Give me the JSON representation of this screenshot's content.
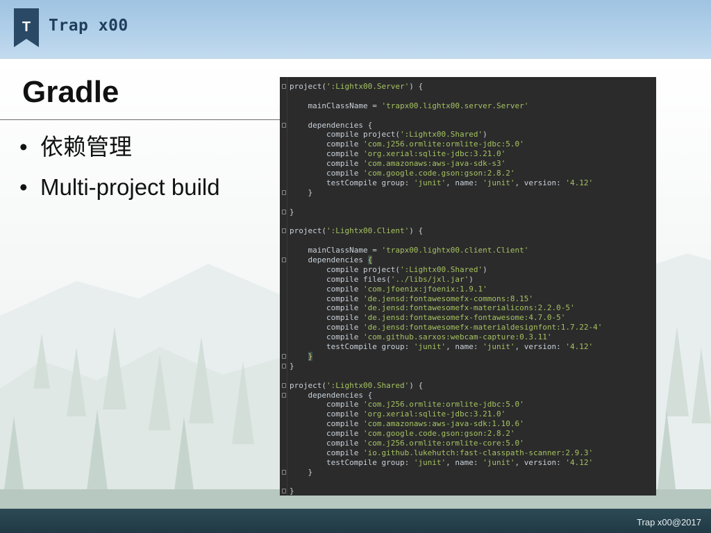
{
  "header": {
    "logo_letter": "T",
    "brand_name": "Trap x00"
  },
  "slide": {
    "title": "Gradle",
    "bullets": [
      {
        "bullet": "•",
        "text": "依赖管理"
      },
      {
        "bullet": "•",
        "text": "Multi-project build"
      }
    ]
  },
  "code": {
    "lines": [
      {
        "gutter": true,
        "segments": [
          {
            "t": "project("
          },
          {
            "t": "':Lightx00.Server'",
            "s": 1
          },
          {
            "t": ") {"
          }
        ]
      },
      {
        "gutter": false,
        "segments": []
      },
      {
        "gutter": false,
        "segments": [
          {
            "t": "    mainClassName = "
          },
          {
            "t": "'trapx00.lightx00.server.Server'",
            "s": 1
          }
        ]
      },
      {
        "gutter": false,
        "segments": []
      },
      {
        "gutter": true,
        "segments": [
          {
            "t": "    dependencies {"
          }
        ]
      },
      {
        "gutter": false,
        "segments": [
          {
            "t": "        compile project("
          },
          {
            "t": "':Lightx00.Shared'",
            "s": 1
          },
          {
            "t": ")"
          }
        ]
      },
      {
        "gutter": false,
        "segments": [
          {
            "t": "        compile "
          },
          {
            "t": "'com.j256.ormlite:ormlite-jdbc:5.0'",
            "s": 1
          }
        ]
      },
      {
        "gutter": false,
        "segments": [
          {
            "t": "        compile "
          },
          {
            "t": "'org.xerial:sqlite-jdbc:3.21.0'",
            "s": 1
          }
        ]
      },
      {
        "gutter": false,
        "segments": [
          {
            "t": "        compile "
          },
          {
            "t": "'com.amazonaws:aws-java-sdk-s3'",
            "s": 1
          }
        ]
      },
      {
        "gutter": false,
        "segments": [
          {
            "t": "        compile "
          },
          {
            "t": "'com.google.code.gson:gson:2.8.2'",
            "s": 1
          }
        ]
      },
      {
        "gutter": false,
        "segments": [
          {
            "t": "        testCompile group: "
          },
          {
            "t": "'junit'",
            "s": 1
          },
          {
            "t": ", name: "
          },
          {
            "t": "'junit'",
            "s": 1
          },
          {
            "t": ", version: "
          },
          {
            "t": "'4.12'",
            "s": 1
          }
        ]
      },
      {
        "gutter": true,
        "segments": [
          {
            "t": "    }"
          }
        ]
      },
      {
        "gutter": false,
        "segments": []
      },
      {
        "gutter": true,
        "segments": [
          {
            "t": "}"
          }
        ]
      },
      {
        "gutter": false,
        "segments": []
      },
      {
        "gutter": true,
        "segments": [
          {
            "t": "project("
          },
          {
            "t": "':Lightx00.Client'",
            "s": 1
          },
          {
            "t": ") {"
          }
        ]
      },
      {
        "gutter": false,
        "segments": []
      },
      {
        "gutter": false,
        "segments": [
          {
            "t": "    mainClassName = "
          },
          {
            "t": "'trapx00.lightx00.client.Client'",
            "s": 1
          }
        ]
      },
      {
        "gutter": true,
        "segments": [
          {
            "t": "    dependencies "
          },
          {
            "t": "{",
            "h": 1
          }
        ]
      },
      {
        "gutter": false,
        "segments": [
          {
            "t": "        compile project("
          },
          {
            "t": "':Lightx00.Shared'",
            "s": 1
          },
          {
            "t": ")"
          }
        ]
      },
      {
        "gutter": false,
        "segments": [
          {
            "t": "        compile files("
          },
          {
            "t": "'../libs/jxl.jar'",
            "s": 1
          },
          {
            "t": ")"
          }
        ]
      },
      {
        "gutter": false,
        "segments": [
          {
            "t": "        compile "
          },
          {
            "t": "'com.jfoenix:jfoenix:1.9.1'",
            "s": 1
          }
        ]
      },
      {
        "gutter": false,
        "segments": [
          {
            "t": "        compile "
          },
          {
            "t": "'de.jensd:fontawesomefx-commons:8.15'",
            "s": 1
          }
        ]
      },
      {
        "gutter": false,
        "segments": [
          {
            "t": "        compile "
          },
          {
            "t": "'de.jensd:fontawesomefx-materialicons:2.2.0-5'",
            "s": 1
          }
        ]
      },
      {
        "gutter": false,
        "segments": [
          {
            "t": "        compile "
          },
          {
            "t": "'de.jensd:fontawesomefx-fontawesome:4.7.0-5'",
            "s": 1
          }
        ]
      },
      {
        "gutter": false,
        "segments": [
          {
            "t": "        compile "
          },
          {
            "t": "'de.jensd:fontawesomefx-materialdesignfont:1.7.22-4'",
            "s": 1
          }
        ]
      },
      {
        "gutter": false,
        "segments": [
          {
            "t": "        compile "
          },
          {
            "t": "'com.github.sarxos:webcam-capture:0.3.11'",
            "s": 1
          }
        ]
      },
      {
        "gutter": false,
        "segments": [
          {
            "t": "        testCompile group: "
          },
          {
            "t": "'junit'",
            "s": 1
          },
          {
            "t": ", name: "
          },
          {
            "t": "'junit'",
            "s": 1
          },
          {
            "t": ", version: "
          },
          {
            "t": "'4.12'",
            "s": 1
          }
        ]
      },
      {
        "gutter": true,
        "segments": [
          {
            "t": "    "
          },
          {
            "t": "}",
            "h": 1
          }
        ]
      },
      {
        "gutter": true,
        "segments": [
          {
            "t": "}"
          }
        ]
      },
      {
        "gutter": false,
        "segments": []
      },
      {
        "gutter": true,
        "segments": [
          {
            "t": "project("
          },
          {
            "t": "':Lightx00.Shared'",
            "s": 1
          },
          {
            "t": ") {"
          }
        ]
      },
      {
        "gutter": true,
        "segments": [
          {
            "t": "    dependencies {"
          }
        ]
      },
      {
        "gutter": false,
        "segments": [
          {
            "t": "        compile "
          },
          {
            "t": "'com.j256.ormlite:ormlite-jdbc:5.0'",
            "s": 1
          }
        ]
      },
      {
        "gutter": false,
        "segments": [
          {
            "t": "        compile "
          },
          {
            "t": "'org.xerial:sqlite-jdbc:3.21.0'",
            "s": 1
          }
        ]
      },
      {
        "gutter": false,
        "segments": [
          {
            "t": "        compile "
          },
          {
            "t": "'com.amazonaws:aws-java-sdk:1.10.6'",
            "s": 1
          }
        ]
      },
      {
        "gutter": false,
        "segments": [
          {
            "t": "        compile "
          },
          {
            "t": "'com.google.code.gson:gson:2.8.2'",
            "s": 1
          }
        ]
      },
      {
        "gutter": false,
        "segments": [
          {
            "t": "        compile "
          },
          {
            "t": "'com.j256.ormlite:ormlite-core:5.0'",
            "s": 1
          }
        ]
      },
      {
        "gutter": false,
        "segments": [
          {
            "t": "        compile "
          },
          {
            "t": "'io.github.lukehutch:fast-classpath-scanner:2.9.3'",
            "s": 1
          }
        ]
      },
      {
        "gutter": false,
        "segments": [
          {
            "t": "        testCompile group: "
          },
          {
            "t": "'junit'",
            "s": 1
          },
          {
            "t": ", name: "
          },
          {
            "t": "'junit'",
            "s": 1
          },
          {
            "t": ", version: "
          },
          {
            "t": "'4.12'",
            "s": 1
          }
        ]
      },
      {
        "gutter": true,
        "segments": [
          {
            "t": "    }"
          }
        ]
      },
      {
        "gutter": false,
        "segments": []
      },
      {
        "gutter": true,
        "segments": [
          {
            "t": "}"
          }
        ]
      }
    ]
  },
  "footer": {
    "text": "Trap x00@2017"
  },
  "colors": {
    "header_blue": "#b3d1ea",
    "brand_text": "#1e3e5c",
    "code_bg": "#2b2b2b",
    "code_text": "#c9d1d9",
    "code_string": "#a5c261",
    "brace_highlight": "#e0c46c",
    "footer_bg": "#213a45"
  }
}
